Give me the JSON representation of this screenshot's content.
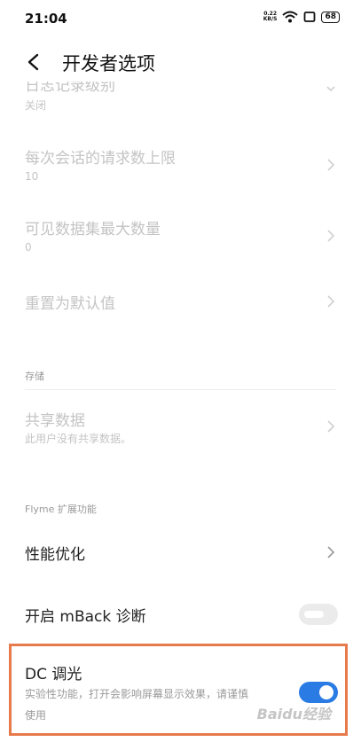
{
  "status_bar": {
    "time": "21:04",
    "net_speed_value": "0.22",
    "net_speed_unit": "KB/S",
    "battery": "68",
    "icons": [
      "wifi-icon",
      "screen-icon",
      "battery-icon"
    ]
  },
  "header": {
    "title": "开发者选项"
  },
  "items": [
    {
      "title": "日志记录级别",
      "subtitle": "关闭"
    },
    {
      "title": "每次会话的请求数上限",
      "subtitle": "10"
    },
    {
      "title": "可见数据集最大数量",
      "subtitle": "0"
    },
    {
      "title": "重置为默认值"
    }
  ],
  "storage": {
    "section_label": "存储",
    "shared_data": {
      "title": "共享数据",
      "subtitle": "此用户没有共享数据。"
    }
  },
  "flyme": {
    "section_label": "Flyme 扩展功能",
    "performance": {
      "title": "性能优化"
    },
    "mback": {
      "title": "开启 mBack 诊断",
      "enabled": false
    },
    "dc": {
      "title": "DC 调光",
      "subtitle_line1": "实验性功能，打开会影响屏幕显示效果，请谨慎",
      "subtitle_line2": "使用",
      "enabled": true
    }
  },
  "watermark": "Baidu经验",
  "colors": {
    "accent": "#2b7be4",
    "highlight_border": "#e77a4a",
    "disabled_text": "#c4c4c4"
  }
}
